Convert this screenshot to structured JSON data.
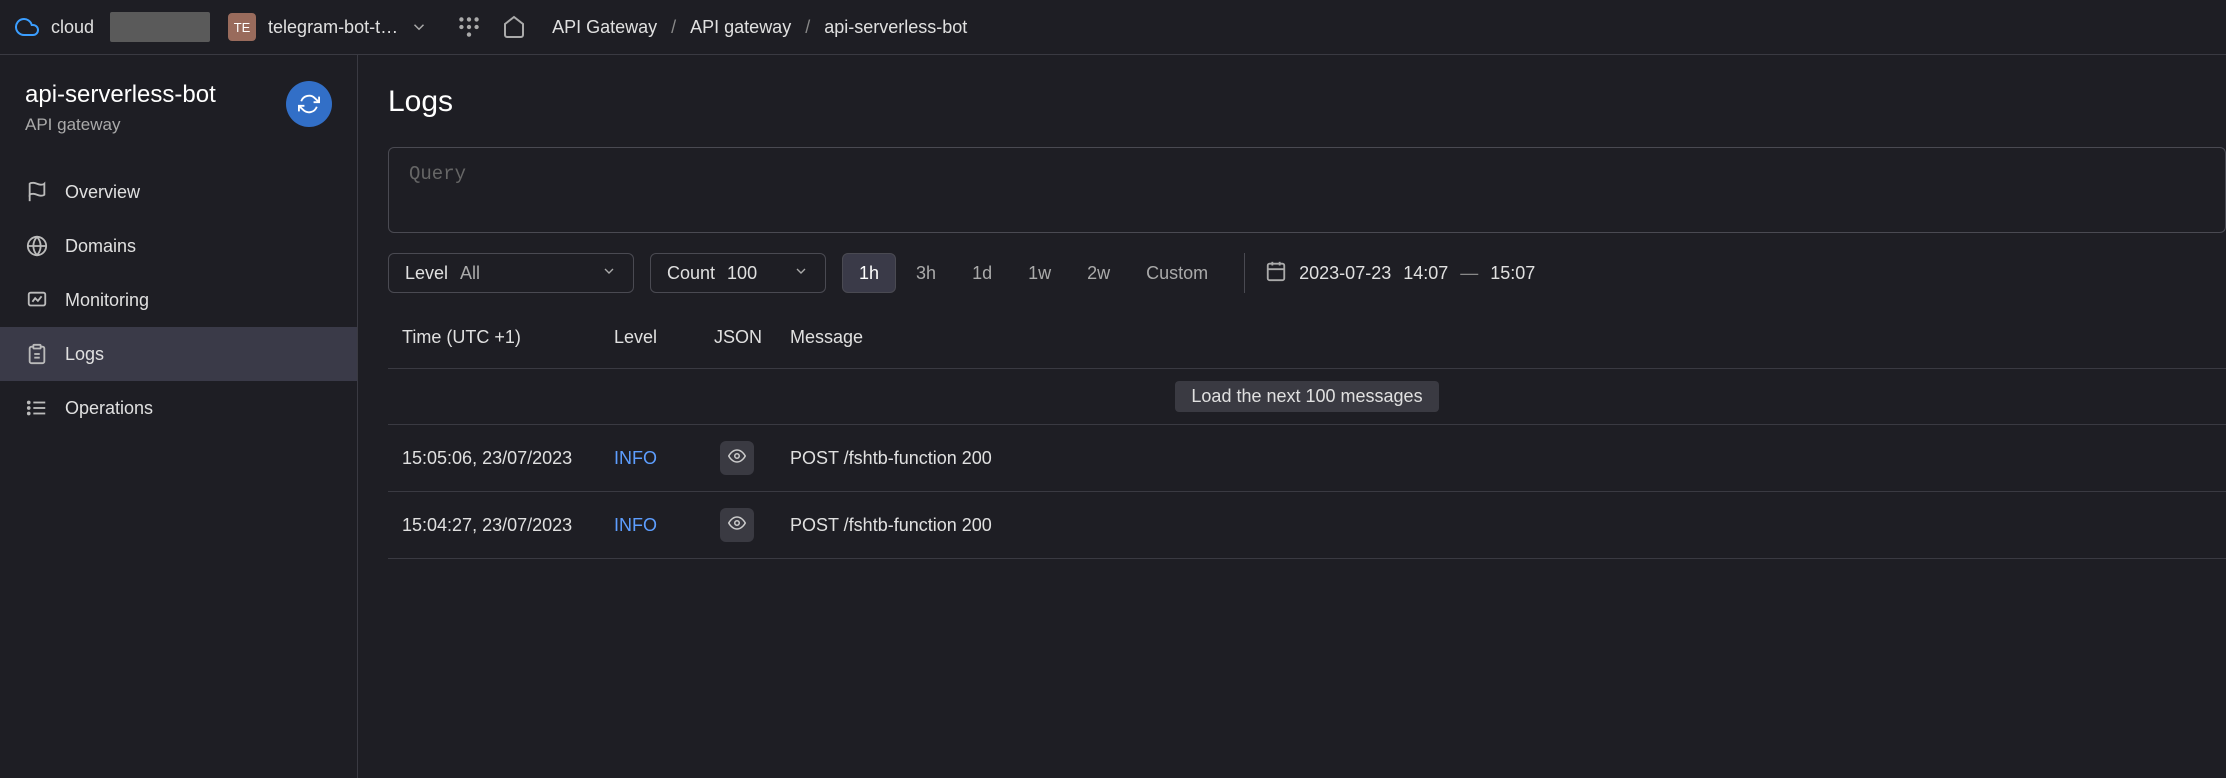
{
  "header": {
    "cloud_label": "cloud",
    "project_badge": "TE",
    "project_name": "telegram-bot-t…",
    "breadcrumbs": [
      "API Gateway",
      "API gateway",
      "api-serverless-bot"
    ]
  },
  "sidebar": {
    "title": "api-serverless-bot",
    "subtitle": "API gateway",
    "items": [
      {
        "label": "Overview",
        "icon": "flag"
      },
      {
        "label": "Domains",
        "icon": "globe"
      },
      {
        "label": "Monitoring",
        "icon": "monitor"
      },
      {
        "label": "Logs",
        "icon": "clipboard",
        "active": true
      },
      {
        "label": "Operations",
        "icon": "list"
      }
    ]
  },
  "content": {
    "title": "Logs",
    "query_placeholder": "Query",
    "filters": {
      "level_label": "Level",
      "level_value": "All",
      "count_label": "Count",
      "count_value": "100",
      "ranges": [
        "1h",
        "3h",
        "1d",
        "1w",
        "2w",
        "Custom"
      ],
      "active_range": "1h",
      "date": "2023-07-23",
      "time_from": "14:07",
      "time_to": "15:07",
      "dash": "—"
    },
    "columns": {
      "time": "Time (UTC +1)",
      "level": "Level",
      "json": "JSON",
      "message": "Message"
    },
    "load_more": "Load the next 100 messages",
    "rows": [
      {
        "time": "15:05:06, 23/07/2023",
        "level": "INFO",
        "message": "POST /fshtb-function 200"
      },
      {
        "time": "15:04:27, 23/07/2023",
        "level": "INFO",
        "message": "POST /fshtb-function 200"
      }
    ]
  }
}
